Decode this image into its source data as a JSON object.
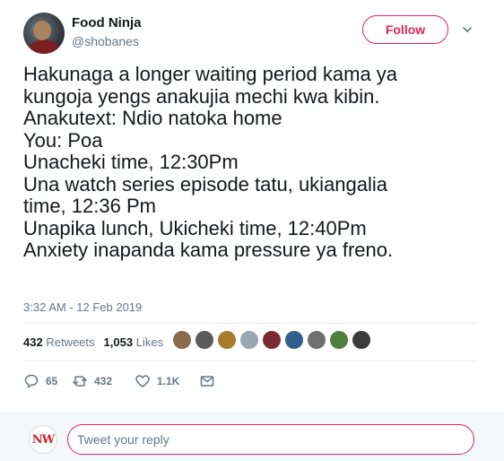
{
  "user": {
    "display_name": "Food Ninja",
    "handle": "@shobanes",
    "follow_label": "Follow"
  },
  "tweet": {
    "lines": [
      "Hakunaga a longer waiting period kama ya",
      "kungoja yengs anakujia mechi kwa kibin.",
      "Anakutext: Ndio natoka home",
      "You: Poa",
      "Unacheki time, 12:30Pm",
      "Una watch series episode tatu, ukiangalia",
      "time, 12:36 Pm",
      "Unapika lunch, Ukicheki time, 12:40Pm",
      "Anxiety inapanda kama pressure ya freno."
    ],
    "timestamp": "3:32 AM - 12 Feb 2019"
  },
  "stats": {
    "retweets_count": "432",
    "retweets_label": "Retweets",
    "likes_count": "1,053",
    "likes_label": "Likes",
    "liker_avatar_colors": [
      "#8a6d4b",
      "#5b5b5b",
      "#a97b2e",
      "#9aa7b3",
      "#7a2a35",
      "#2f5f8a",
      "#6f6f6f",
      "#4f7f3f",
      "#3b3b3b"
    ]
  },
  "actions": {
    "reply_count": "65",
    "retweet_count": "432",
    "like_count": "1.1K"
  },
  "reply_bar": {
    "avatar_text": "NW",
    "placeholder": "Tweet your reply"
  },
  "colors": {
    "accent": "#e0245e",
    "secondary_text": "#657786",
    "divider": "#e6ecf0"
  }
}
